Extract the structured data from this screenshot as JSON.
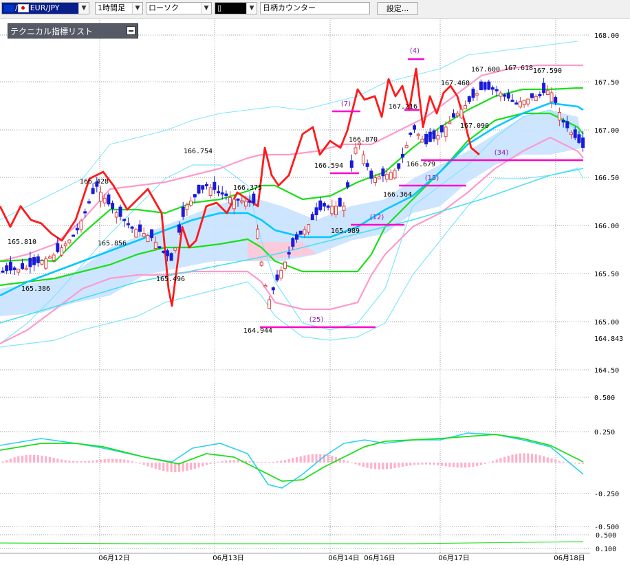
{
  "toolbar": {
    "pair": "EUR/JPY",
    "timeframe": "1時間足",
    "chart_type": "ローソク",
    "tool_icon": "candle-tool-icon",
    "counter": "日柄カウンター",
    "settings": "設定..."
  },
  "indicator_panel": {
    "title": "テクニカル指標リスト"
  },
  "price_axis": {
    "ticks": [
      "168.00",
      "167.50",
      "167.00",
      "166.50",
      "166.00",
      "165.50",
      "165.00",
      "164.843",
      "164.50"
    ],
    "current": "164.843"
  },
  "macd_axis": {
    "ticks": [
      "0.500",
      "0.250",
      "-0.250",
      "-0.500"
    ]
  },
  "sub_axis": {
    "ticks": [
      "0.500",
      "0.100"
    ]
  },
  "dates": [
    "06月12日",
    "06月13日",
    "06月14日",
    "06月16日",
    "06月17日",
    "06月18日"
  ],
  "peaks": [
    "165.810",
    "165.386",
    "166.428",
    "165.856",
    "165.496",
    "166.754",
    "166.375",
    "164.944",
    "166.594",
    "165.989",
    "166.870",
    "166.364",
    "167.216",
    "166.679",
    "167.460",
    "167.090",
    "167.600",
    "167.618",
    "167.590"
  ],
  "counts": [
    "(25)",
    "(12)",
    "(7)",
    "(15)",
    "(4)",
    "(34)"
  ],
  "colors": {
    "bull": "#d94040",
    "bear": "#1a1ad9",
    "ma_fast": "#00c8ff",
    "ma_mid": "#18e018",
    "boll": "#ff99cc",
    "boll_outer": "#7fe5ff",
    "chikou": "#ff1a1a",
    "count": "#ff00cc"
  },
  "chart_data": [
    {
      "type": "line",
      "ylim": [
        164.4,
        168.0
      ],
      "yticks": [
        164.5,
        165.0,
        165.5,
        166.0,
        166.5,
        167.0,
        167.5,
        168.0
      ]
    },
    {
      "type": "bar",
      "ylim": [
        -0.5,
        0.5
      ],
      "yticks": [
        -0.25,
        0.25,
        0.5
      ]
    }
  ]
}
